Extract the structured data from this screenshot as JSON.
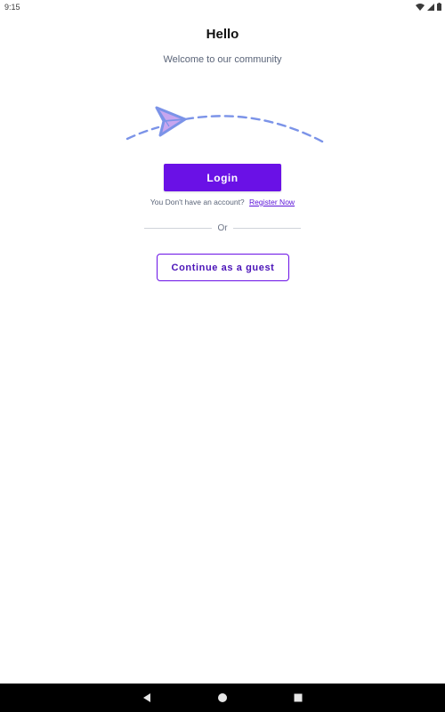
{
  "status_bar": {
    "time": "9:15",
    "icons": [
      "wifi-icon",
      "signal-icon",
      "battery-icon"
    ]
  },
  "header": {
    "title": "Hello",
    "subtitle": "Welcome to our community"
  },
  "illustration": {
    "icon": "paper-plane-icon",
    "colors": {
      "plane_outline": "#7b93e8",
      "plane_fill": "#c8a6ef",
      "trail": "#7b93e8"
    }
  },
  "login": {
    "label": "Login",
    "color": "#6a11e6"
  },
  "register": {
    "prompt": "You Don't have an account?",
    "link_label": "Register Now"
  },
  "divider": {
    "label": "Or"
  },
  "guest": {
    "label": "Continue as a guest"
  },
  "nav_bar": {
    "icons": [
      "back-icon",
      "home-icon",
      "recents-icon"
    ]
  }
}
